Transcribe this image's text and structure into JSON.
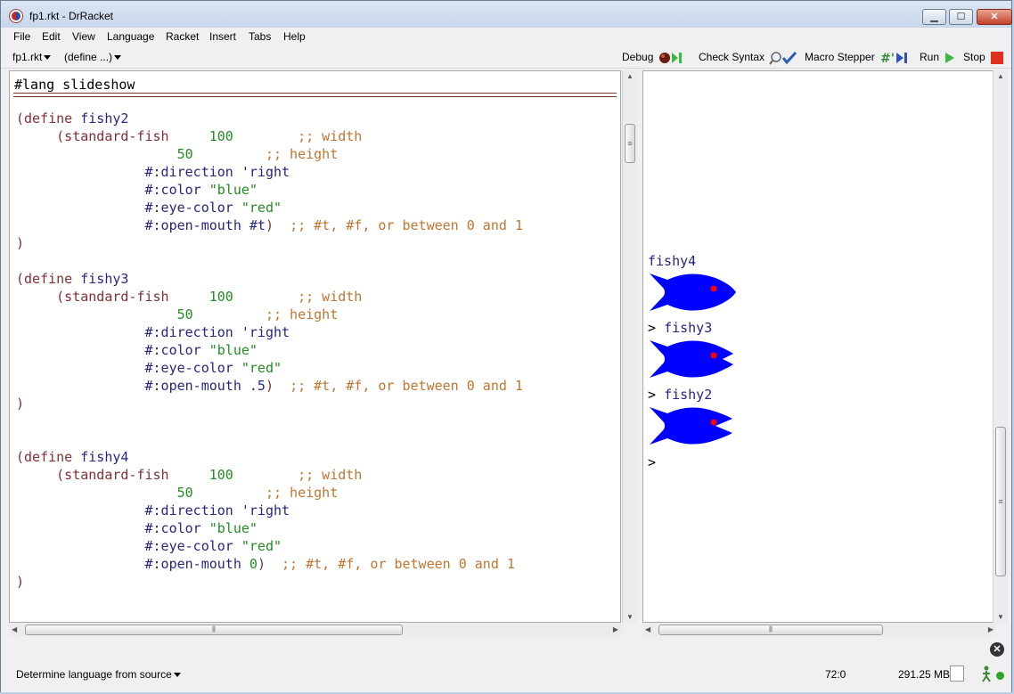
{
  "window": {
    "title": "fp1.rkt - DrRacket",
    "buttons": {
      "minimize": "▁",
      "maximize": "☐",
      "close": "✕"
    }
  },
  "menu": [
    "File",
    "Edit",
    "View",
    "Language",
    "Racket",
    "Insert",
    "Tabs",
    "Help"
  ],
  "toolbar": {
    "file_menu": "fp1.rkt",
    "define_menu": "(define ...)",
    "debug": "Debug",
    "check_syntax": "Check Syntax",
    "macro_stepper": "Macro Stepper",
    "run": "Run",
    "stop": "Stop"
  },
  "editor": {
    "lang_line": "#lang slideshow",
    "blocks": [
      {
        "name": "fishy2",
        "width": "100",
        "width_comment": ";; width",
        "height": "50",
        "height_comment": ";; height",
        "direction": "'right",
        "color": "\"blue\"",
        "eye_color": "\"red\"",
        "open_mouth": "#t",
        "open_mouth_comment": ";; #t, #f, or between 0 and 1"
      },
      {
        "name": "fishy3",
        "width": "100",
        "width_comment": ";; width",
        "height": "50",
        "height_comment": ";; height",
        "direction": "'right",
        "color": "\"blue\"",
        "eye_color": "\"red\"",
        "open_mouth": ".5",
        "open_mouth_comment": ";; #t, #f, or between 0 and 1"
      },
      {
        "name": "fishy4",
        "width": "100",
        "width_comment": ";; width",
        "height": "50",
        "height_comment": ";; height",
        "direction": "'right",
        "color": "\"blue\"",
        "eye_color": "\"red\"",
        "open_mouth": "0",
        "open_mouth_comment": ";; #t, #f, or between 0 and 1"
      }
    ]
  },
  "repl": {
    "entries": [
      {
        "prompt": "",
        "name": "fishy4"
      },
      {
        "prompt": "> ",
        "name": "fishy3"
      },
      {
        "prompt": "> ",
        "name": "fishy2"
      }
    ],
    "final_prompt": ">",
    "fish_color": "#0000ff",
    "eye_color": "#ff0000"
  },
  "status": {
    "language": "Determine language from source",
    "position": "72:0",
    "memory": "291.25 MB"
  }
}
